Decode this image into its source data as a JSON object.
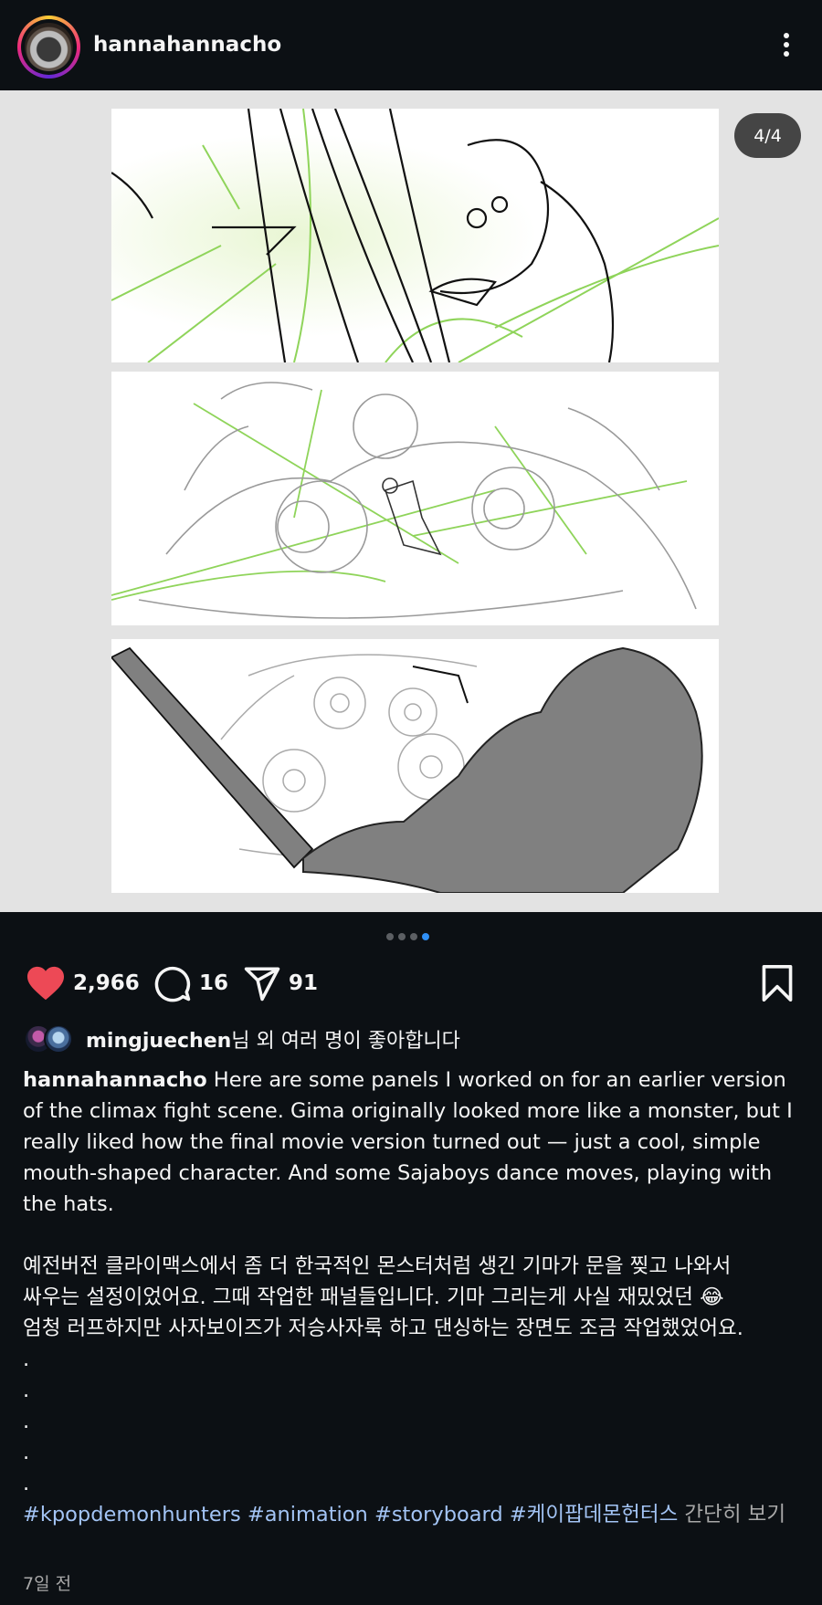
{
  "header": {
    "username": "hannahannacho",
    "avatar_icon": "profile-avatar",
    "more_icon": "more-vertical-icon"
  },
  "media": {
    "counter": "4/4",
    "total_pages": 4,
    "current_page": 4,
    "background": "#e3e3e3"
  },
  "actions": {
    "likes": "2,966",
    "comments": "16",
    "shares": "91",
    "like_color": "#ed4956"
  },
  "liked_by": {
    "user": "mingjuechen",
    "suffix": "님 외 여러 명이 좋아합니다"
  },
  "caption": {
    "user": "hannahannacho",
    "text": " Here are some panels I worked on for an earlier version of the climax fight scene. Gima originally looked more like a monster, but I really liked how the final movie version turned out — just a cool, simple mouth-shaped character. And some Sajaboys dance moves, playing with the hats.",
    "korean_1": "예전버전 클라이맥스에서 좀 더 한국적인 몬스터처럼 생긴 기마가 문을 찢고 나와서",
    "korean_2": "싸우는 설정이었어요. 그때 작업한 패널들입니다. 기마 그리는게 사실 재밌었던 😂",
    "korean_3": "엄청 러프하지만 사자보이즈가 저승사자룩 하고 댄싱하는 장면도 조금 작업했었어요.",
    "dots": [
      ".",
      ".",
      ".",
      ".",
      "."
    ],
    "hashtags": "#kpopdemonhunters #animation #storyboard #케이팝데몬헌터스",
    "more": " 간단히 보기"
  },
  "timestamp": "7일 전",
  "colors": {
    "accent": "#2f8ff5",
    "hashtag": "#a3c4f5",
    "muted": "#a8a8a8"
  }
}
